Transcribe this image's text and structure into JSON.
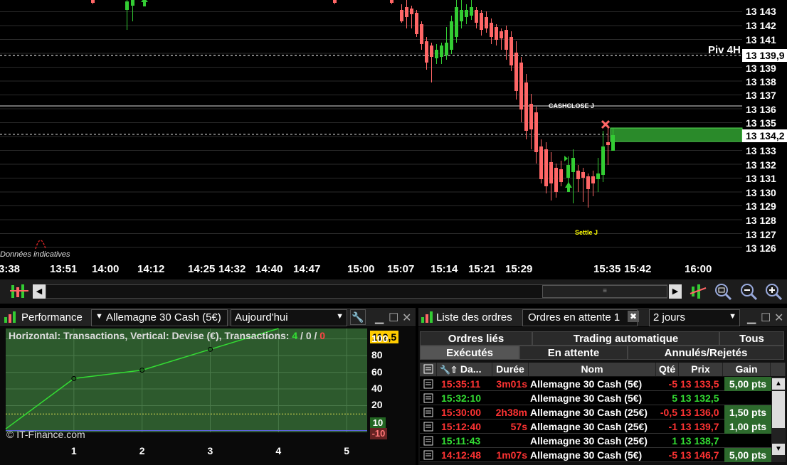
{
  "chart": {
    "price_labels": [
      "13 143",
      "13 142",
      "13 141",
      "13 139,9",
      "13 139",
      "13 138",
      "13 137",
      "13 136",
      "13 135",
      "13 134,2",
      "13 133",
      "13 132",
      "13 131",
      "13 130",
      "13 129",
      "13 128",
      "13 127",
      "13 126"
    ],
    "time_labels": [
      "3:38",
      "13:51",
      "14:00",
      "14:12",
      "14:25",
      "14:32",
      "14:40",
      "14:47",
      "15:00",
      "15:07",
      "15:14",
      "15:21",
      "15:29",
      "15:35",
      "15:42",
      "16:00"
    ],
    "piv_label": "Piv 4H",
    "cashclose_label": "CASHCLOSE J",
    "settle_label": "Settle J",
    "disclaimer": "Données indicatives",
    "colors": {
      "up": "#33cc33",
      "down": "#ff6666",
      "price_box": "#ffffff"
    }
  },
  "perf": {
    "icon": "performance-icon",
    "title": "Performance",
    "instrument": "Allemagne 30 Cash (5€)",
    "period": "Aujourd'hui",
    "info_prefix": "Horizontal: Transactions, Vertical: Devise (€), Transactions: ",
    "tx_win": "4",
    "tx_sep1": " / ",
    "tx_zero": "0",
    "tx_sep2": " / ",
    "tx_loss": "0",
    "y_labels": [
      "100",
      "80",
      "60",
      "40",
      "20"
    ],
    "x_labels": [
      "1",
      "2",
      "3",
      "4",
      "5"
    ],
    "current_value": "112,5",
    "pos_value": "10",
    "neg_value": "-10",
    "watermark": "© IT-Finance.com",
    "chart_data": {
      "type": "line",
      "x": [
        0,
        1,
        2,
        3,
        4
      ],
      "values": [
        -8,
        52.5,
        62.5,
        87.5,
        112.5
      ],
      "ylim": [
        -12,
        112.5
      ],
      "xlim": [
        0,
        5.3
      ]
    }
  },
  "orders": {
    "title": "Liste des ordres",
    "filter": "Ordres en attente 1",
    "period": "2 jours",
    "tabs_top": [
      "Ordres liés",
      "Trading automatique",
      "Tous"
    ],
    "tabs_bottom": [
      "Exécutés",
      "En attente",
      "Annulés/Rejetés"
    ],
    "columns": [
      "Da...",
      "Durée",
      "Nom",
      "Qté",
      "Prix",
      "Gain"
    ],
    "rows": [
      {
        "time": "15:35:11",
        "duration": "3m01s",
        "name": "Allemagne 30 Cash (5€)",
        "qty": "-5",
        "price": "13 133,5",
        "gain": "5,00 pts",
        "side": "sell"
      },
      {
        "time": "15:32:10",
        "duration": "",
        "name": "Allemagne 30 Cash (5€)",
        "qty": "5",
        "price": "13 132,5",
        "gain": "",
        "side": "buy"
      },
      {
        "time": "15:30:00",
        "duration": "2h38m",
        "name": "Allemagne 30 Cash (25€)",
        "qty": "-0,5",
        "price": "13 136,0",
        "gain": "1,50 pts",
        "side": "sell"
      },
      {
        "time": "15:12:40",
        "duration": "57s",
        "name": "Allemagne 30 Cash (25€)",
        "qty": "-1",
        "price": "13 139,7",
        "gain": "1,00 pts",
        "side": "sell"
      },
      {
        "time": "15:11:43",
        "duration": "",
        "name": "Allemagne 30 Cash (25€)",
        "qty": "1",
        "price": "13 138,7",
        "gain": "",
        "side": "buy"
      },
      {
        "time": "14:12:48",
        "duration": "1m07s",
        "name": "Allemagne 30 Cash (5€)",
        "qty": "-5",
        "price": "13 146,7",
        "gain": "5,00 pts",
        "side": "sell"
      }
    ]
  }
}
